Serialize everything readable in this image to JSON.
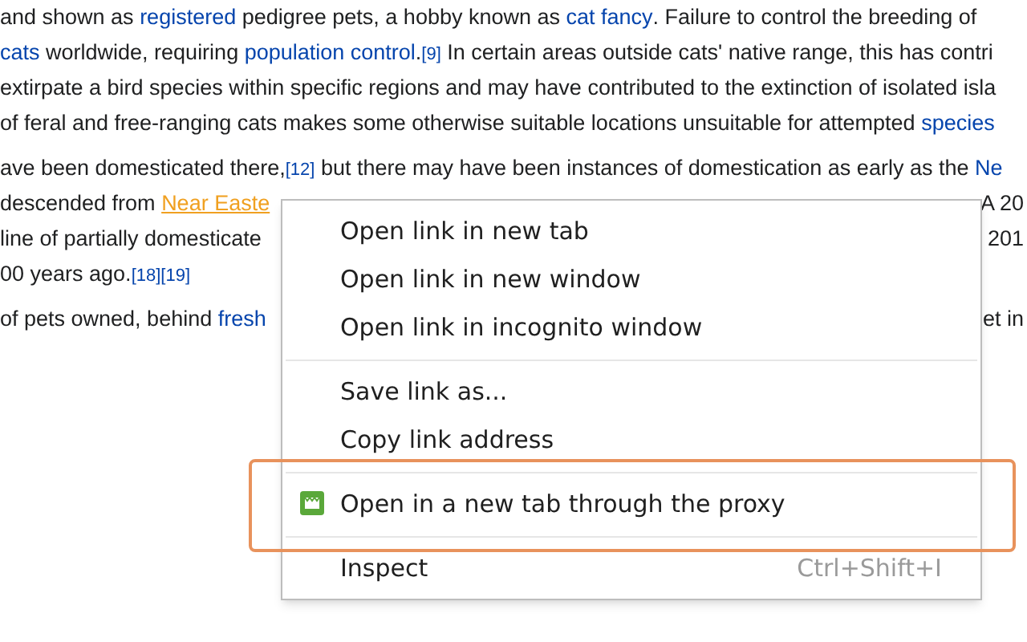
{
  "article": {
    "paragraphs": [
      {
        "lines": [
          {
            "left": [
              {
                "kind": "text",
                "text": "and shown as "
              },
              {
                "kind": "link",
                "text": "registered"
              },
              {
                "kind": "text",
                "text": " pedigree pets, a hobby known as "
              },
              {
                "kind": "link",
                "text": "cat fancy"
              },
              {
                "kind": "text",
                "text": ". Failure to control the breeding of"
              }
            ]
          },
          {
            "left": [
              {
                "kind": "link",
                "text": "cats"
              },
              {
                "kind": "text",
                "text": " worldwide, requiring "
              },
              {
                "kind": "link",
                "text": "population control"
              },
              {
                "kind": "text",
                "text": "."
              },
              {
                "kind": "ref",
                "text": "[9]"
              },
              {
                "kind": "text",
                "text": " In certain areas outside cats' native range, this has contri"
              }
            ]
          },
          {
            "left": [
              {
                "kind": "text",
                "text": "extirpate a bird species within specific regions and may have contributed to the extinction of isolated isla"
              }
            ]
          },
          {
            "left": [
              {
                "kind": "text",
                "text": "of feral and free-ranging cats makes some otherwise suitable locations unsuitable for attempted "
              },
              {
                "kind": "link",
                "text": "species"
              }
            ]
          }
        ]
      },
      {
        "lines": [
          {
            "left": [
              {
                "kind": "text",
                "text": "ave been domesticated there,"
              },
              {
                "kind": "ref",
                "text": "[12]"
              },
              {
                "kind": "text",
                "text": " but there may have been instances of domestication as early as the "
              },
              {
                "kind": "link",
                "text": "Ne"
              }
            ]
          },
          {
            "left": [
              {
                "kind": "text",
                "text": "descended from "
              },
              {
                "kind": "hover_link",
                "text": "Near Easte"
              }
            ],
            "right": [
              {
                "kind": "text",
                "text": "A 20"
              }
            ]
          },
          {
            "left": [
              {
                "kind": "text",
                "text": "line of partially domesticate"
              }
            ],
            "right": [
              {
                "kind": "text",
                "text": "201"
              }
            ]
          },
          {
            "left": [
              {
                "kind": "text",
                "text": "00 years ago."
              },
              {
                "kind": "ref",
                "text": "[18]"
              },
              {
                "kind": "ref",
                "text": "[19]"
              }
            ]
          }
        ]
      },
      {
        "lines": [
          {
            "left": [
              {
                "kind": "text",
                "text": "of pets owned, behind "
              },
              {
                "kind": "link",
                "text": "fresh"
              }
            ],
            "right": [
              {
                "kind": "text",
                "text": "et in"
              }
            ]
          }
        ]
      }
    ]
  },
  "context_menu": {
    "items": [
      {
        "kind": "item",
        "label": "Open link in new tab"
      },
      {
        "kind": "item",
        "label": "Open link in new window"
      },
      {
        "kind": "item",
        "label": "Open link in incognito window"
      },
      {
        "kind": "separator"
      },
      {
        "kind": "item",
        "label": "Save link as..."
      },
      {
        "kind": "item",
        "label": "Copy link address"
      },
      {
        "kind": "separator"
      },
      {
        "kind": "icon_item",
        "label": "Open in a new tab through the proxy",
        "highlighted": true
      },
      {
        "kind": "separator"
      },
      {
        "kind": "item",
        "label": "Inspect",
        "shortcut": "Ctrl+Shift+I"
      }
    ]
  }
}
